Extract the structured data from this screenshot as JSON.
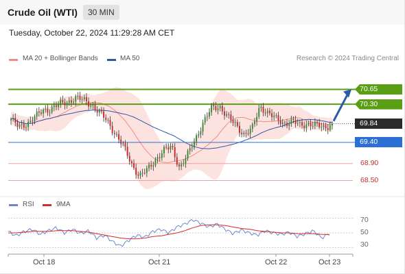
{
  "header": {
    "title": "Crude Oil (WTI)",
    "timeframe": "30 MIN",
    "datetime": "Tuesday, October 22, 2024 11:29:28 AM CET"
  },
  "legend": {
    "bollinger_label": "MA 20 + Bollinger Bands",
    "ma50_label": "MA 50",
    "credit": "Research © 2024 Trading Central",
    "rsi_label": "RSI",
    "ma9_label": "9MA",
    "colors": {
      "bollinger": "#f08c84",
      "ma50": "#2f56a3",
      "rsi": "#6a86cf",
      "ma9": "#d42a2a"
    }
  },
  "chart_data": [
    {
      "type": "candlestick",
      "ylim": [
        68.2,
        70.95
      ],
      "x_ticks": [
        "Oct 18",
        "Oct 21",
        "Oct 22",
        "Oct 23"
      ],
      "levels": [
        {
          "value": 70.65,
          "label": "70.65",
          "kind": "resistance",
          "color": "#5a9e16"
        },
        {
          "value": 70.3,
          "label": "70.30",
          "kind": "resistance",
          "color": "#5a9e16"
        },
        {
          "value": 69.84,
          "label": "69.84",
          "kind": "last_price",
          "color": "#333333"
        },
        {
          "value": 69.4,
          "label": "69.40",
          "kind": "pivot",
          "color": "#2b6fd4"
        },
        {
          "value": 68.9,
          "label": "68.90",
          "kind": "support",
          "color": "#e05050"
        },
        {
          "value": 68.5,
          "label": "68.50",
          "kind": "support",
          "color": "#e05050"
        }
      ],
      "projection": {
        "from": 69.84,
        "to": 70.65,
        "direction": "up"
      },
      "close_path": [
        69.95,
        69.75,
        69.85,
        70.0,
        70.15,
        70.2,
        70.3,
        70.35,
        70.45,
        70.4,
        70.3,
        70.1,
        69.9,
        69.6,
        69.3,
        68.9,
        68.6,
        68.75,
        69.0,
        69.2,
        69.3,
        68.8,
        69.1,
        69.5,
        69.9,
        70.2,
        70.25,
        70.0,
        69.8,
        69.6,
        69.7,
        70.25,
        70.1,
        69.95,
        69.85,
        69.9,
        69.8,
        69.85,
        69.8,
        69.75,
        69.84
      ],
      "last_price": 69.84
    },
    {
      "type": "line",
      "title": "RSI",
      "ylim": [
        25,
        75
      ],
      "y_ticks": [
        70,
        50,
        30
      ],
      "series": [
        {
          "name": "RSI",
          "values": [
            52,
            46,
            52,
            55,
            48,
            53,
            57,
            50,
            55,
            49,
            53,
            43,
            47,
            38,
            32,
            40,
            47,
            44,
            52,
            55,
            50,
            58,
            62,
            68,
            63,
            58,
            62,
            55,
            49,
            54,
            50,
            47,
            53,
            50,
            48,
            51,
            45,
            49,
            53,
            43,
            49
          ]
        },
        {
          "name": "9MA",
          "values": [
            50,
            50,
            51,
            52,
            52,
            52,
            53,
            53,
            53,
            52,
            51,
            49,
            47,
            45,
            43,
            42,
            42,
            43,
            45,
            46,
            48,
            50,
            53,
            57,
            60,
            61,
            61,
            60,
            58,
            56,
            55,
            53,
            52,
            51,
            50,
            50,
            49,
            49,
            49,
            48,
            48
          ]
        }
      ]
    }
  ]
}
